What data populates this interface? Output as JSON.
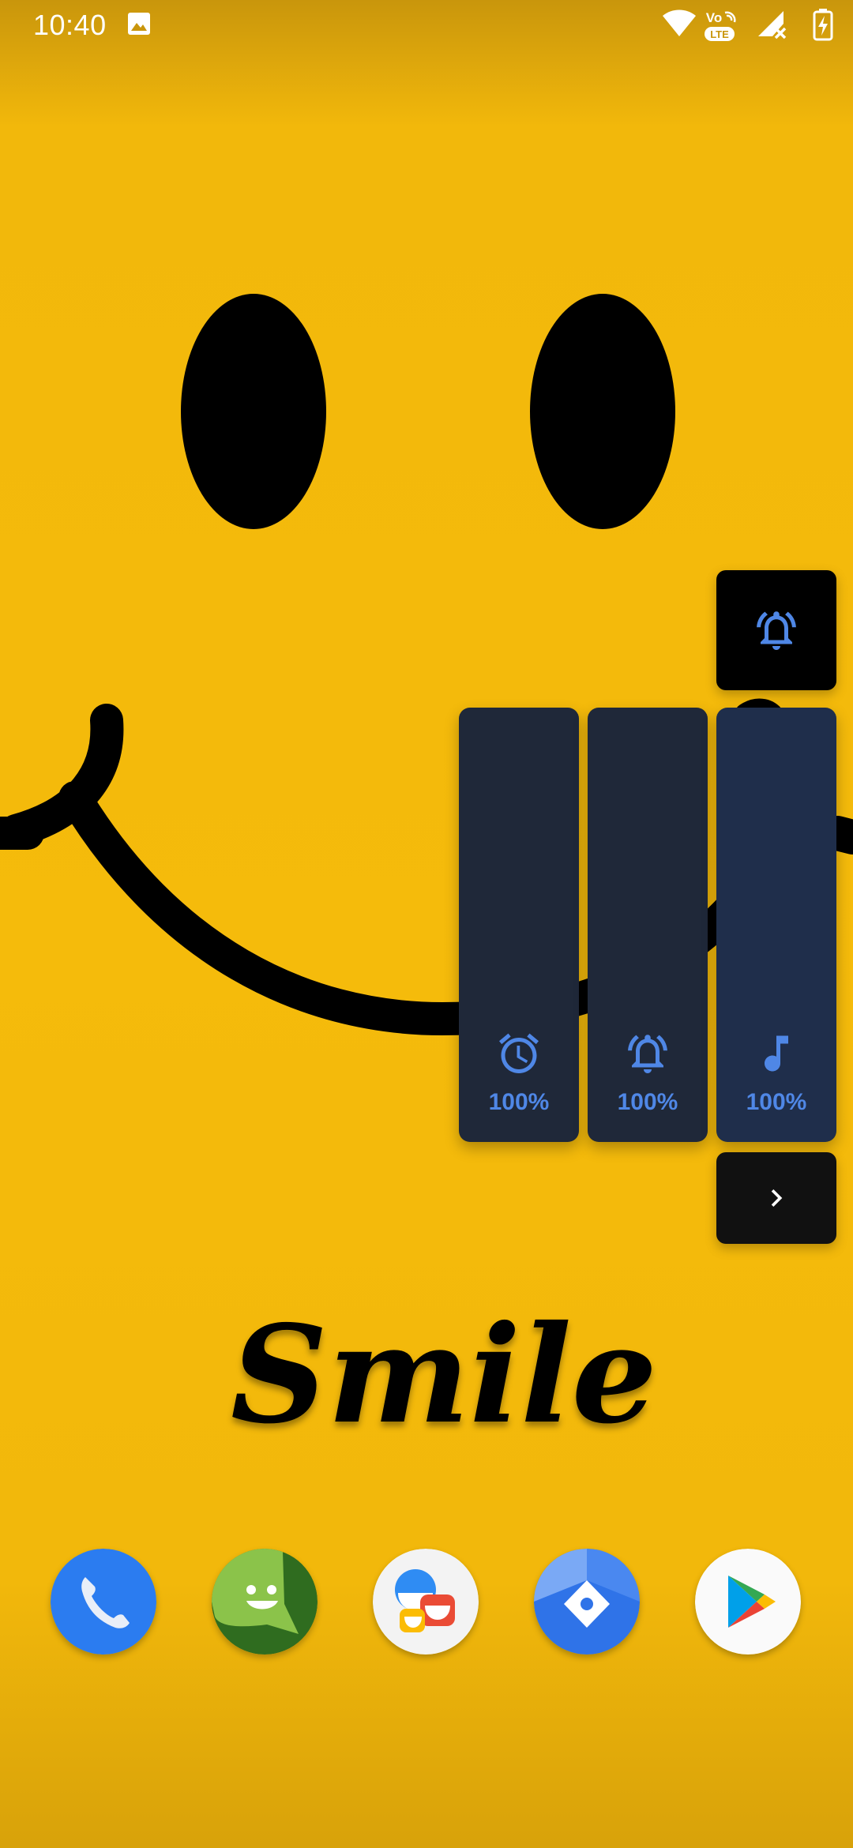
{
  "status_bar": {
    "time": "10:40",
    "icons": [
      "gallery-notification-icon",
      "wifi-icon",
      "volte-lte-icon",
      "no-signal-icon",
      "battery-charging-icon"
    ],
    "volte_top": "Vo",
    "volte_bottom": "LTE"
  },
  "wallpaper": {
    "text": "Smile",
    "colors": {
      "background": "#f5bb0b",
      "ink": "#000000"
    }
  },
  "volume_panel": {
    "ringer_mode": {
      "icon": "bell-ringing-icon"
    },
    "sliders": [
      {
        "stream": "alarm",
        "icon": "alarm-clock-icon",
        "level_percent": 100,
        "label": "100%"
      },
      {
        "stream": "ring",
        "icon": "bell-ringing-icon",
        "level_percent": 100,
        "label": "100%"
      },
      {
        "stream": "media",
        "icon": "music-note-icon",
        "level_percent": 100,
        "label": "100%"
      }
    ],
    "expand": {
      "icon": "chevron-right-icon"
    },
    "colors": {
      "accent": "#4f87e6",
      "slider_bg": "#1f2839",
      "active_slider_bg": "#1f2e4b"
    }
  },
  "dock": {
    "apps": [
      {
        "icon": "phone-app-icon"
      },
      {
        "icon": "messaging-app-icon"
      },
      {
        "icon": "allo-chat-app-icon"
      },
      {
        "icon": "files-app-icon"
      },
      {
        "icon": "play-store-app-icon"
      }
    ]
  }
}
